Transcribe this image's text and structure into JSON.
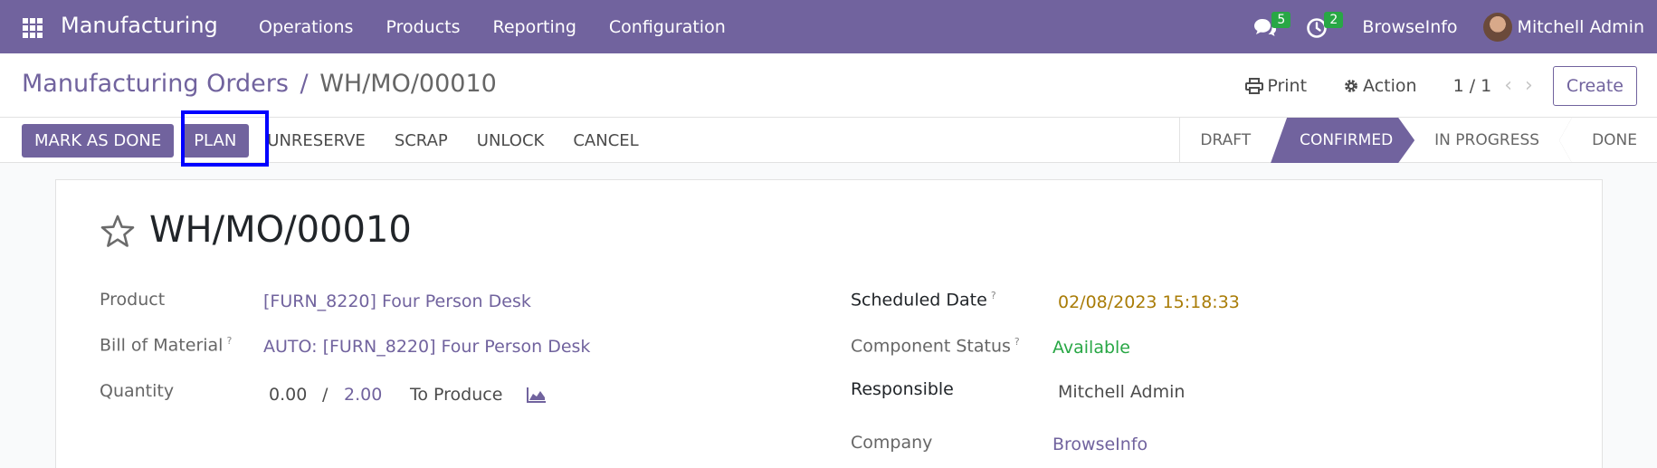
{
  "navbar": {
    "app_title": "Manufacturing",
    "menu": [
      "Operations",
      "Products",
      "Reporting",
      "Configuration"
    ],
    "messages_count": "5",
    "activities_count": "2",
    "company": "BrowseInfo",
    "user": "Mitchell Admin"
  },
  "control_panel": {
    "breadcrumb_parent": "Manufacturing Orders",
    "breadcrumb_sep": "/",
    "breadcrumb_current": "WH/MO/00010",
    "print_label": "Print",
    "action_label": "Action",
    "pager": "1 / 1",
    "create_label": "Create"
  },
  "statusbar": {
    "buttons": {
      "mark_done": "MARK AS DONE",
      "plan": "PLAN",
      "unreserve": "UNRESERVE",
      "scrap": "SCRAP",
      "unlock": "UNLOCK",
      "cancel": "CANCEL"
    },
    "stages": {
      "draft": "DRAFT",
      "confirmed": "CONFIRMED",
      "in_progress": "IN PROGRESS",
      "done": "DONE"
    }
  },
  "form": {
    "name": "WH/MO/00010",
    "product_label": "Product",
    "product_value": "[FURN_8220] Four Person Desk",
    "bom_label": "Bill of Material",
    "bom_value": "AUTO: [FURN_8220] Four Person Desk",
    "qty_label": "Quantity",
    "qty_produced": "0.00",
    "qty_sep": "/",
    "qty_total": "2.00",
    "qty_suffix": "To Produce",
    "scheduled_label": "Scheduled Date",
    "scheduled_value": "02/08/2023 15:18:33",
    "component_label": "Component Status",
    "component_value": "Available",
    "responsible_label": "Responsible",
    "responsible_value": "Mitchell Admin",
    "company_label": "Company",
    "company_value": "BrowseInfo",
    "help_mark": "?"
  },
  "colors": {
    "brand": "#71639e",
    "warning_date": "#a97c07",
    "available": "#28a745",
    "highlight": "#0000ff"
  }
}
